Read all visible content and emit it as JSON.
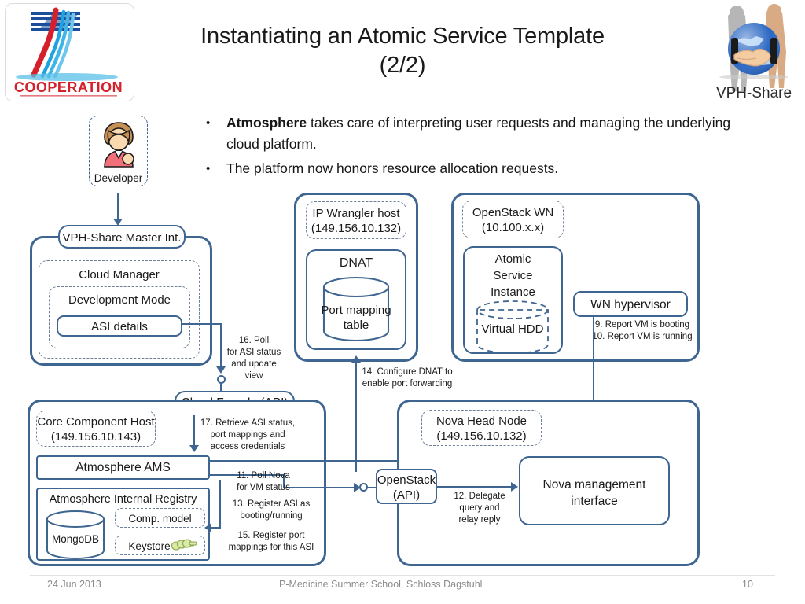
{
  "slide": {
    "title_line1": "Instantiating an Atomic Service Template",
    "title_line2": "(2/2)",
    "logo_left_text": "COOPERATION",
    "logo_right_text": "VPH-Share"
  },
  "bullets": [
    {
      "bold": "Atmosphere",
      "rest": " takes care of interpreting user requests and managing the underlying cloud platform."
    },
    {
      "bold": "",
      "rest": "The platform now honors resource allocation requests."
    }
  ],
  "diagram": {
    "developer": "Developer",
    "master_interface": "VPH-Share Master Int.",
    "cloud_manager": "Cloud Manager",
    "development_mode": "Development Mode",
    "asi_details": "ASI details",
    "ip_wrangler_host_line1": "IP Wrangler host",
    "ip_wrangler_host_line2": "(149.156.10.132)",
    "dnat": "DNAT",
    "port_mapping_table_line1": "Port mapping",
    "port_mapping_table_line2": "table",
    "openstack_wn_line1": "OpenStack WN",
    "openstack_wn_line2": "(10.100.x.x)",
    "atomic_service_instance_line1": "Atomic",
    "atomic_service_instance_line2": "Service",
    "atomic_service_instance_line3": "Instance",
    "virtual_hdd": "Virtual HDD",
    "wn_hypervisor": "WN hypervisor",
    "cloud_facade": "Cloud Facade (API)",
    "core_component_host_line1": "Core Component Host",
    "core_component_host_line2": "(149.156.10.143)",
    "atmosphere_ams": "Atmosphere AMS",
    "atmosphere_internal_registry": "Atmosphere Internal Registry",
    "mongodb": "MongoDB",
    "comp_model": "Comp. model",
    "keystore": "Keystore",
    "nova_head_node_line1": "Nova Head Node",
    "nova_head_node_line2": "(149.156.10.132)",
    "openstack_api_line1": "OpenStack",
    "openstack_api_line2": "(API)",
    "nova_management_line1": "Nova management",
    "nova_management_line2": "interface"
  },
  "notes": {
    "step9": "9. Report VM is booting",
    "step10": "10. Report VM is running",
    "step11_l1": "11. Poll Nova",
    "step11_l2": "for VM status",
    "step12_l1": "12. Delegate",
    "step12_l2": "query and",
    "step12_l3": "relay reply",
    "step13_l1": "13. Register ASI as",
    "step13_l2": "booting/running",
    "step14_l1": "14. Configure DNAT to",
    "step14_l2": "enable port forwarding",
    "step15_l1": "15. Register port",
    "step15_l2": "mappings for this ASI",
    "step16_l1": "16. Poll",
    "step16_l2": "for ASI status",
    "step16_l3": "and update",
    "step16_l4": "view",
    "step17_l1": "17. Retrieve ASI status,",
    "step17_l2": "port mappings and",
    "step17_l3": "access credentials"
  },
  "footer": {
    "date": "24 Jun 2013",
    "center": "P-Medicine Summer School, Schloss Dagstuhl",
    "page": "10"
  },
  "colors": {
    "box_border": "#3f6591",
    "dash_border": "#6b7f99",
    "footer_text": "#8a8a8a"
  }
}
